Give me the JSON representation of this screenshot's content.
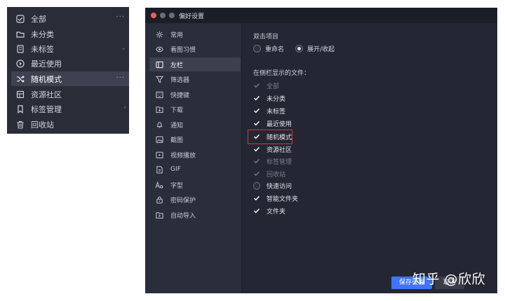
{
  "sidebar": {
    "items": [
      {
        "label": "全部",
        "icon": "all-box-icon"
      },
      {
        "label": "未分类",
        "icon": "folder-icon"
      },
      {
        "label": "未标签",
        "icon": "tag-page-icon"
      },
      {
        "label": "最近使用",
        "icon": "clock-icon"
      },
      {
        "label": "随机模式",
        "icon": "shuffle-icon",
        "active": true,
        "more": "···"
      },
      {
        "label": "资源社区",
        "icon": "cube-icon"
      },
      {
        "label": "标签管理",
        "icon": "bookmark-icon"
      },
      {
        "label": "回收站",
        "icon": "trash-icon"
      }
    ]
  },
  "window": {
    "title": "偏好设置",
    "traffic_lights": [
      "#ee5f57",
      "#6b6e78",
      "#6b6e78"
    ]
  },
  "nav": {
    "items": [
      {
        "label": "常用",
        "icon": "gear-icon"
      },
      {
        "label": "看图习惯",
        "icon": "eye-icon"
      },
      {
        "label": "左栏",
        "icon": "sidebar-icon",
        "active": true
      },
      {
        "label": "筛选器",
        "icon": "filter-icon"
      },
      {
        "label": "快捷键",
        "icon": "keyboard-icon"
      },
      {
        "label": "下载",
        "icon": "download-icon"
      },
      {
        "label": "通知",
        "icon": "bell-icon"
      },
      {
        "label": "截图",
        "icon": "screenshot-icon"
      },
      {
        "label": "视频播放",
        "icon": "play-icon"
      },
      {
        "label": "GIF",
        "icon": "gif-icon"
      },
      {
        "label": "字型",
        "icon": "font-icon"
      },
      {
        "label": "密码保护",
        "icon": "lock-icon"
      },
      {
        "label": "自动导入",
        "icon": "import-icon"
      }
    ]
  },
  "content": {
    "double_click_title": "双击项目",
    "radio_options": [
      {
        "label": "重命名",
        "selected": false
      },
      {
        "label": "展开/收起",
        "selected": true
      }
    ],
    "show_files_title": "在侧栏显示的文件：",
    "checkboxes": [
      {
        "label": "全部",
        "state": "disabled"
      },
      {
        "label": "未分类",
        "state": "checked"
      },
      {
        "label": "未标签",
        "state": "checked"
      },
      {
        "label": "最近使用",
        "state": "checked"
      },
      {
        "label": "随机模式",
        "state": "checked"
      },
      {
        "label": "资源社区",
        "state": "checked"
      },
      {
        "label": "标签管理",
        "state": "disabled"
      },
      {
        "label": "回收站",
        "state": "disabled"
      },
      {
        "label": "快速访问",
        "state": "unchecked"
      },
      {
        "label": "智能文件夹",
        "state": "checked"
      },
      {
        "label": "文件夹",
        "state": "checked"
      }
    ],
    "save_label": "保存设置",
    "cancel_label": "取消"
  },
  "watermark": "知乎 @欣欣",
  "colors": {
    "accent": "#3f74ff",
    "highlight_border": "#d8333a",
    "panel_bg": "#242733"
  }
}
